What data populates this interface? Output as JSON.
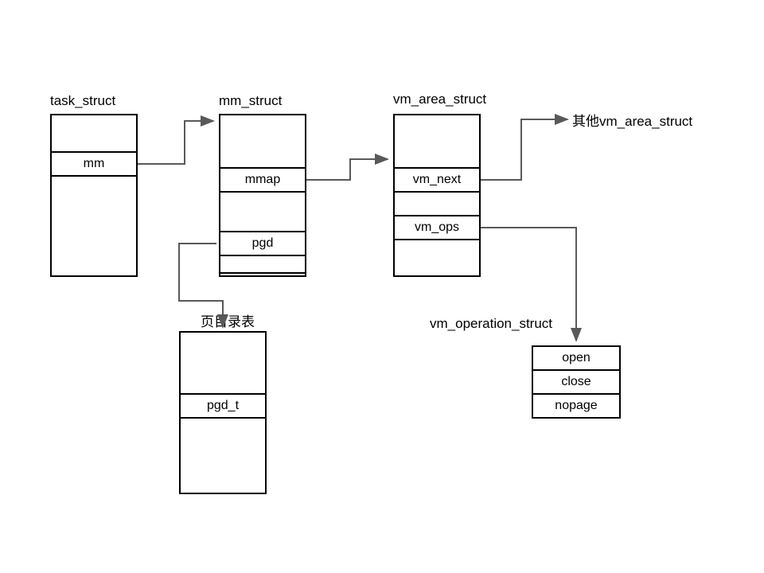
{
  "labels": {
    "task_struct": "task_struct",
    "mm_struct": "mm_struct",
    "vm_area_struct": "vm_area_struct",
    "other_vm_area": "其他vm_area_struct",
    "page_dir_table": "页目录表",
    "vm_operation_struct": "vm_operation_struct"
  },
  "fields": {
    "mm": "mm",
    "mmap": "mmap",
    "pgd": "pgd",
    "vm_next": "vm_next",
    "vm_ops": "vm_ops",
    "pgd_t": "pgd_t",
    "open": "open",
    "close": "close",
    "nopage": "nopage"
  }
}
